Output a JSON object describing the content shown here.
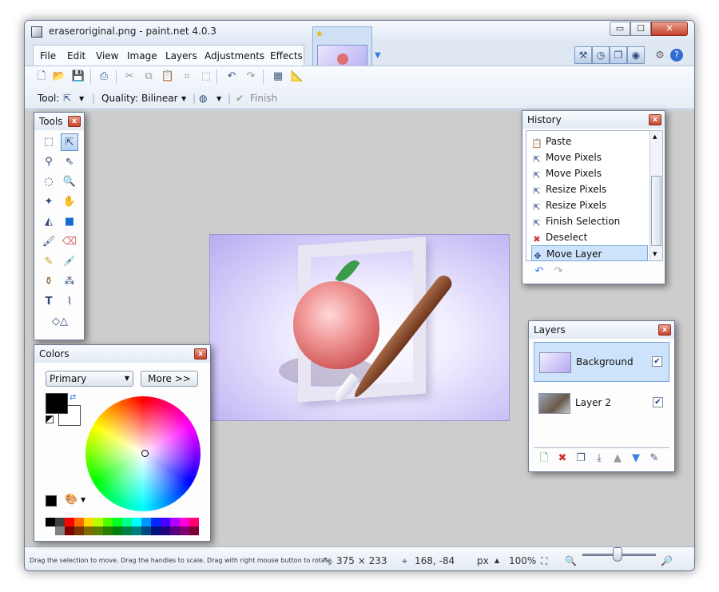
{
  "window": {
    "title": "eraseroriginal.png - paint.net 4.0.3",
    "buttons": {
      "minimize": "▭",
      "maximize": "☐",
      "close": "✕"
    }
  },
  "menu": [
    "File",
    "Edit",
    "View",
    "Image",
    "Layers",
    "Adjustments",
    "Effects"
  ],
  "toolbar": {
    "tool_label": "Tool:",
    "quality_label": "Quality:",
    "quality_value": "Bilinear",
    "finish_label": "Finish"
  },
  "tools_panel": {
    "title": "Tools",
    "close": "x"
  },
  "history_panel": {
    "title": "History",
    "close": "x",
    "items": [
      "Paste",
      "Move Pixels",
      "Move Pixels",
      "Resize Pixels",
      "Resize Pixels",
      "Finish Selection",
      "Deselect",
      "Move Layer"
    ],
    "selected": "Move Layer"
  },
  "layers_panel": {
    "title": "Layers",
    "close": "x",
    "layers": [
      {
        "name": "Background",
        "visible": true,
        "selected": true
      },
      {
        "name": "Layer 2",
        "visible": true,
        "selected": false
      }
    ]
  },
  "colors_panel": {
    "title": "Colors",
    "close": "x",
    "mode": "Primary",
    "more_button": "More >>",
    "primary_color": "#000000",
    "secondary_color": "#ffffff"
  },
  "status": {
    "hint": "Drag the selection to move. Drag the handles to scale. Drag with right mouse button to rotate.",
    "selection_size": "375 × 233",
    "cursor_position": "168, -84",
    "unit": "px",
    "zoom": "100%"
  },
  "colors": {
    "accent": "#3b7de0",
    "canvas_bg": "#cdcdcd",
    "selection_blue": "#cde3fb"
  }
}
